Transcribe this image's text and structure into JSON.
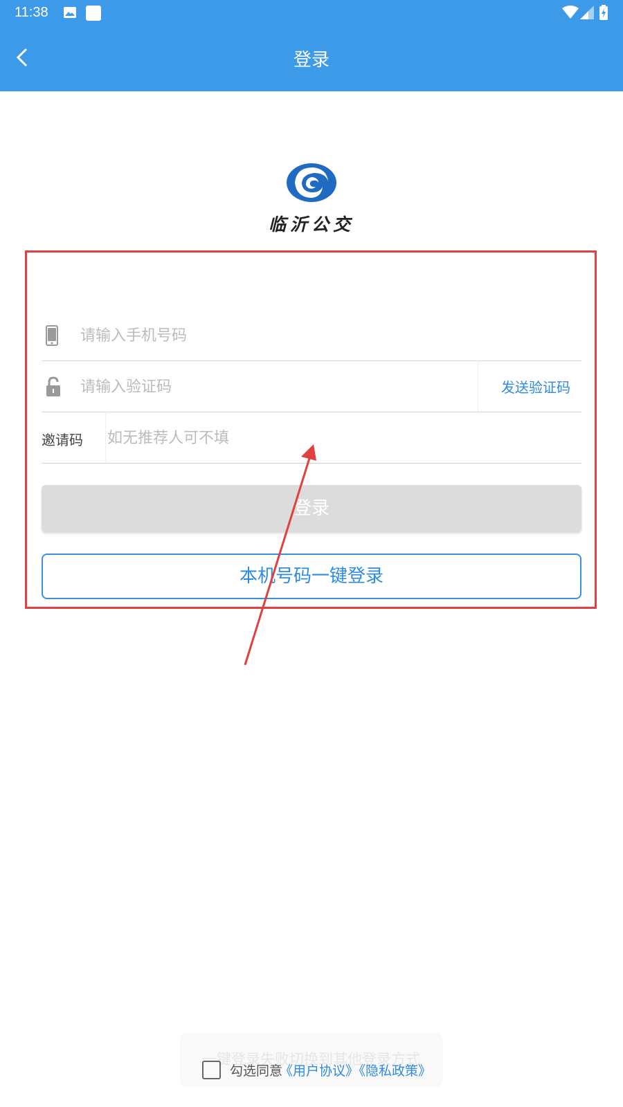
{
  "status_bar": {
    "time": "11:38",
    "icons": [
      "gallery-icon",
      "app-square-icon",
      "wifi-icon",
      "signal-icon",
      "battery-charging-icon"
    ]
  },
  "app_bar": {
    "title": "登录",
    "back_icon": "chevron-left-icon"
  },
  "logo": {
    "text": "临沂公交"
  },
  "form": {
    "phone": {
      "icon": "phone-icon",
      "placeholder": "请输入手机号码",
      "value": ""
    },
    "code": {
      "icon": "unlock-icon",
      "placeholder": "请输入验证码",
      "value": "",
      "send_label": "发送验证码"
    },
    "invite": {
      "label": "邀请码",
      "placeholder": "如无推荐人可不填",
      "value": ""
    },
    "login_label": "登录",
    "one_key_label": "本机号码一键登录"
  },
  "footer": {
    "fallback_text": "一键登录失败切换到其他登录方式",
    "agree_prefix": "勾选同意",
    "user_agreement": "《用户协议》",
    "privacy_policy": "《隐私政策》",
    "agreed": false
  },
  "colors": {
    "primary": "#3d9ae8",
    "link": "#2e8be0",
    "annotation": "#e0403f",
    "disabled_button": "#dcdcdc"
  }
}
